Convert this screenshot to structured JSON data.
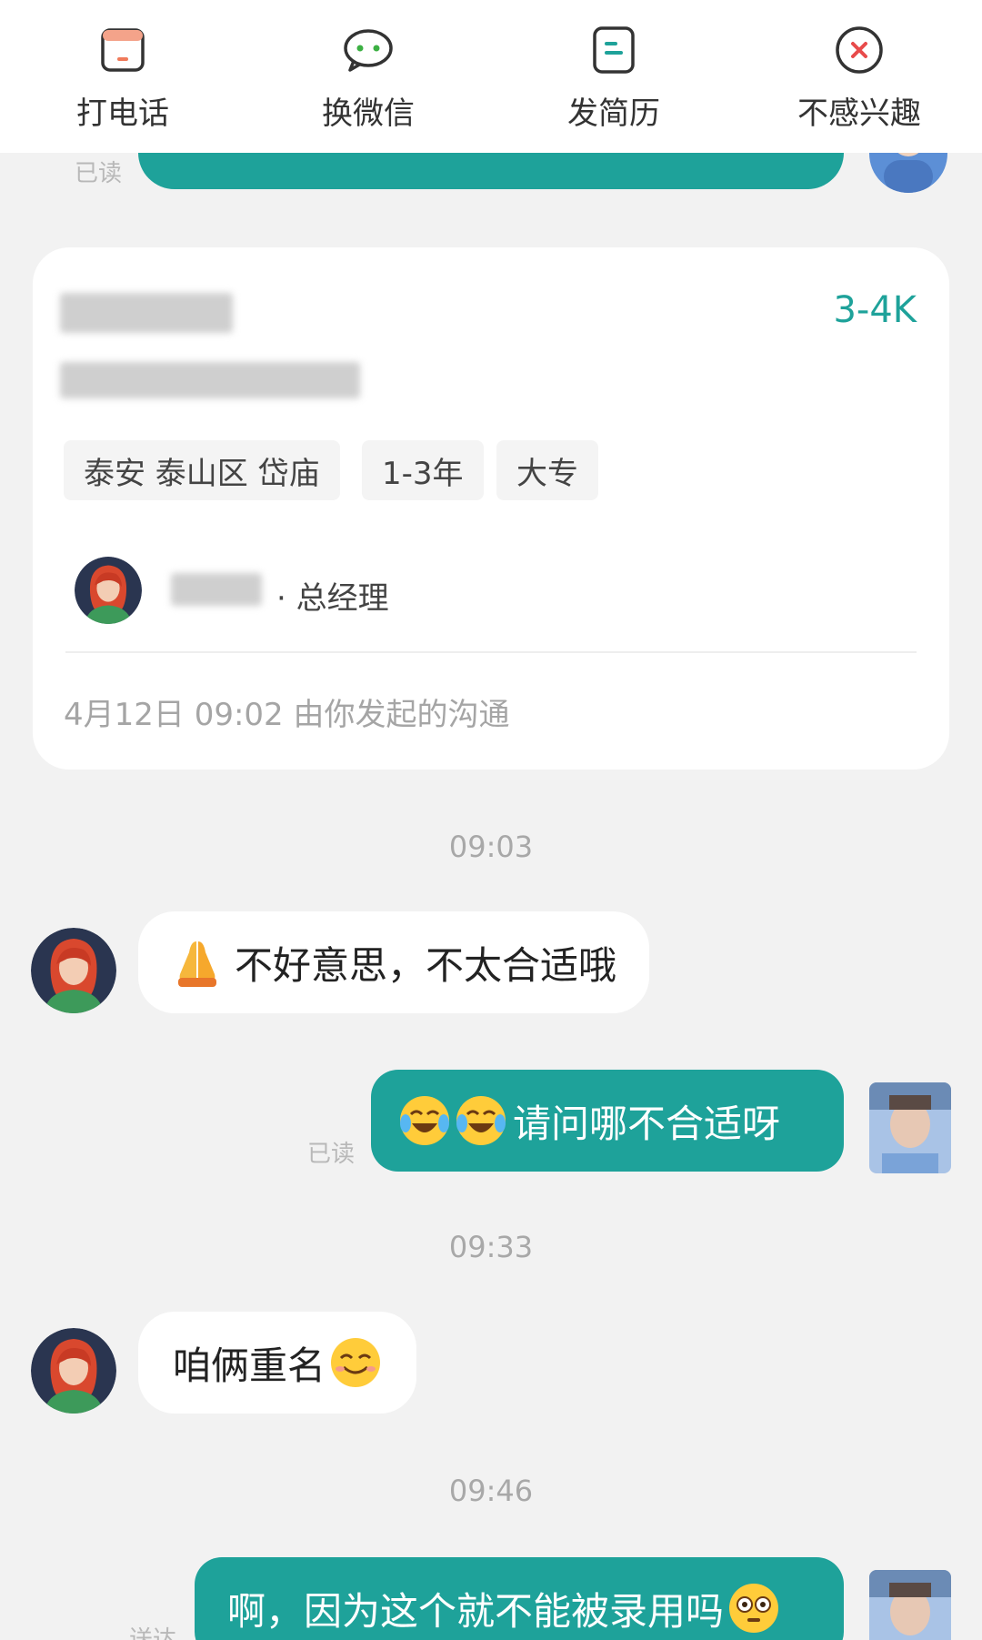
{
  "actions": [
    {
      "label": "打电话",
      "icon": "phone-icon"
    },
    {
      "label": "换微信",
      "icon": "wechat-icon"
    },
    {
      "label": "发简历",
      "icon": "resume-icon"
    },
    {
      "label": "不感兴趣",
      "icon": "not-interested-icon"
    }
  ],
  "status": {
    "read": "已读",
    "delivered": "送达"
  },
  "job_card": {
    "salary": "3-4K",
    "tags": [
      "泰安 泰山区 岱庙",
      "1-3年",
      "大专"
    ],
    "hr_title": "· 总经理",
    "footer": "4月12日 09:02 由你发起的沟通"
  },
  "messages": [
    {
      "time": "09:03"
    },
    {
      "from": "hr",
      "text": "不好意思，不太合适哦",
      "emoji": "pray"
    },
    {
      "from": "me",
      "text": "请问哪不合适呀",
      "emoji": "crying-laughing x2",
      "status": "已读"
    },
    {
      "time": "09:33"
    },
    {
      "from": "hr",
      "text": "咱俩重名",
      "emoji": "grin"
    },
    {
      "time": "09:46"
    },
    {
      "from": "me",
      "text": "啊，因为这个就不能被录用吗",
      "emoji": "flushed",
      "status": "送达"
    }
  ],
  "colors": {
    "accent": "#1ea29a",
    "background": "#f2f2f2",
    "bubble_in": "#ffffff"
  }
}
